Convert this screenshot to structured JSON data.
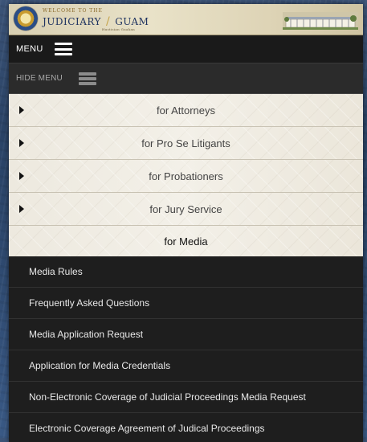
{
  "header": {
    "welcome": "Welcome to the",
    "title_left": "Judiciary",
    "title_sep": "/",
    "title_right": "Guam",
    "subtitle": "Hustisian Guahan"
  },
  "menu": {
    "label": "MENU",
    "hide_label": "HIDE MENU"
  },
  "sections": [
    {
      "label": "for Attorneys",
      "expanded": false
    },
    {
      "label": "for Pro Se Litigants",
      "expanded": false
    },
    {
      "label": "for Probationers",
      "expanded": false
    },
    {
      "label": "for Jury Service",
      "expanded": false
    },
    {
      "label": "for Media",
      "expanded": true
    }
  ],
  "media_items": [
    "Media Rules",
    "Frequently Asked Questions",
    "Media Application Request",
    "Application for Media Credentials",
    "Non-Electronic Coverage of Judicial Proceedings Media Request",
    "Electronic Coverage Agreement of Judical Proceedings"
  ],
  "colors": {
    "dark_bg": "#1e1e1e",
    "accordion_bg": "#f0ede5",
    "title_blue": "#1f3360"
  },
  "icons": {
    "menu": "hamburger-icon",
    "collapsed": "caret-right-icon",
    "seal": "judiciary-seal-icon"
  }
}
